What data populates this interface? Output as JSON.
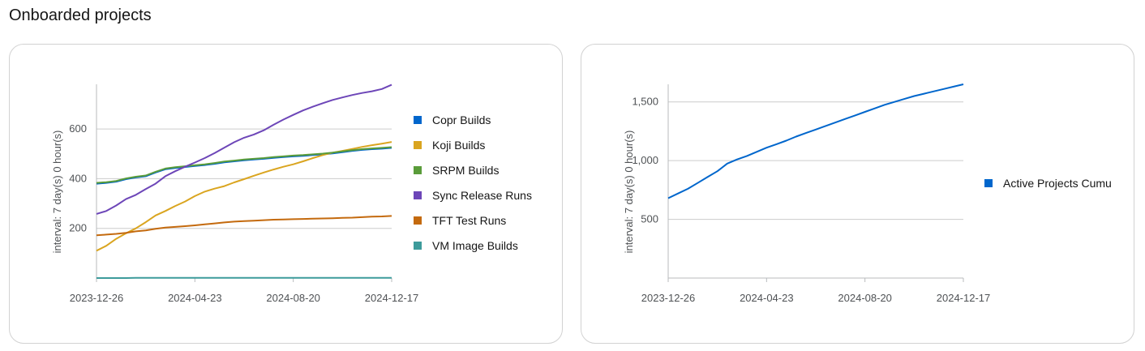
{
  "page": {
    "title": "Onboarded projects"
  },
  "chart_data": [
    {
      "type": "line",
      "ylabel": "interval: 7 day(s) 0 hour(s)",
      "xlabel": "",
      "x_ticks": [
        "2023-12-26",
        "2024-04-23",
        "2024-08-20",
        "2024-12-17"
      ],
      "y_ticks": [
        200,
        400,
        600
      ],
      "y_tick_labels": [
        "200",
        "400",
        "600"
      ],
      "ylim": [
        0,
        780
      ],
      "grid": "horizontal",
      "legend_position": "right",
      "series": [
        {
          "name": "Copr Builds",
          "color": "#0066cc",
          "values": [
            380,
            383,
            388,
            398,
            405,
            410,
            425,
            438,
            443,
            447,
            451,
            455,
            460,
            466,
            470,
            474,
            477,
            480,
            484,
            487,
            490,
            492,
            495,
            498,
            502,
            507,
            512,
            516,
            519,
            521,
            524
          ]
        },
        {
          "name": "Koji Builds",
          "color": "#daa520",
          "values": [
            110,
            130,
            158,
            180,
            200,
            225,
            252,
            270,
            290,
            308,
            330,
            348,
            360,
            370,
            385,
            398,
            412,
            425,
            437,
            448,
            458,
            470,
            483,
            495,
            505,
            512,
            520,
            528,
            535,
            541,
            548
          ]
        },
        {
          "name": "SRPM Builds",
          "color": "#5a9c3a",
          "values": [
            383,
            386,
            391,
            401,
            408,
            413,
            428,
            441,
            446,
            450,
            454,
            458,
            463,
            469,
            473,
            477,
            480,
            483,
            487,
            490,
            493,
            495,
            498,
            501,
            505,
            510,
            515,
            519,
            522,
            524,
            527
          ]
        },
        {
          "name": "Sync Release Runs",
          "color": "#6d46b8",
          "values": [
            258,
            270,
            292,
            318,
            335,
            358,
            380,
            410,
            430,
            448,
            465,
            483,
            503,
            525,
            547,
            565,
            578,
            595,
            617,
            638,
            657,
            675,
            690,
            704,
            717,
            727,
            737,
            745,
            752,
            761,
            778
          ]
        },
        {
          "name": "TFT Test Runs",
          "color": "#c46a0e",
          "values": [
            172,
            175,
            178,
            182,
            188,
            192,
            198,
            203,
            206,
            209,
            212,
            216,
            220,
            224,
            227,
            229,
            231,
            233,
            235,
            236,
            237,
            238,
            239,
            240,
            241,
            242,
            243,
            245,
            247,
            248,
            250
          ]
        },
        {
          "name": "VM Image Builds",
          "color": "#3d9b9b",
          "values": [
            0,
            0,
            0,
            0,
            1,
            1,
            1,
            1,
            1,
            1,
            1,
            1,
            1,
            1,
            1,
            1,
            1,
            1,
            1,
            1,
            1,
            1,
            1,
            1,
            1,
            1,
            1,
            1,
            1,
            1,
            1
          ]
        }
      ]
    },
    {
      "type": "line",
      "ylabel": "interval: 7 day(s) 0 hour(s)",
      "xlabel": "",
      "x_ticks": [
        "2023-12-26",
        "2024-04-23",
        "2024-08-20",
        "2024-12-17"
      ],
      "y_ticks": [
        500,
        1000,
        1500
      ],
      "y_tick_labels": [
        "500",
        "1,000",
        "1,500"
      ],
      "ylim": [
        0,
        1650
      ],
      "grid": "horizontal",
      "legend_position": "right",
      "series": [
        {
          "name": "Active Projects Cumu",
          "color": "#0066cc",
          "values": [
            680,
            720,
            760,
            810,
            860,
            910,
            975,
            1010,
            1040,
            1075,
            1110,
            1140,
            1170,
            1205,
            1235,
            1265,
            1295,
            1325,
            1355,
            1385,
            1415,
            1445,
            1475,
            1500,
            1525,
            1550,
            1570,
            1590,
            1610,
            1630,
            1650
          ]
        }
      ]
    }
  ]
}
